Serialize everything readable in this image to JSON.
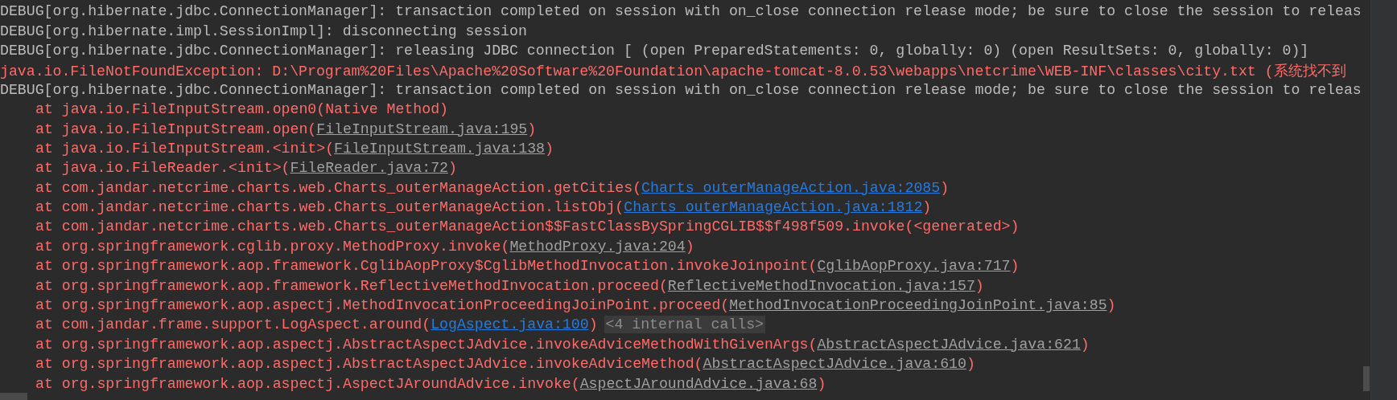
{
  "console": {
    "lines": [
      {
        "kind": "debug",
        "parts": [
          {
            "kind": "text",
            "text": "DEBUG[org.hibernate.jdbc.ConnectionManager]: transaction completed on session with on_close connection release mode; be sure to close the session to releas"
          }
        ]
      },
      {
        "kind": "debug",
        "parts": [
          {
            "kind": "text",
            "text": "DEBUG[org.hibernate.impl.SessionImpl]: disconnecting session"
          }
        ]
      },
      {
        "kind": "debug",
        "parts": [
          {
            "kind": "text",
            "text": "DEBUG[org.hibernate.jdbc.ConnectionManager]: releasing JDBC connection [ (open PreparedStatements: 0, globally: 0) (open ResultSets: 0, globally: 0)]"
          }
        ]
      },
      {
        "kind": "error",
        "parts": [
          {
            "kind": "text",
            "text": "java.io.FileNotFoundException: D:\\Program%20Files\\Apache%20Software%20Foundation\\apache-tomcat-8.0.53\\webapps\\netcrime\\WEB-INF\\classes\\city.txt (系统找不到"
          }
        ]
      },
      {
        "kind": "debug",
        "parts": [
          {
            "kind": "text",
            "text": "DEBUG[org.hibernate.jdbc.ConnectionManager]: transaction completed on session with on_close connection release mode; be sure to close the session to releas"
          }
        ]
      },
      {
        "kind": "frame",
        "parts": [
          {
            "kind": "text",
            "text": "at java.io.FileInputStream.open0(Native Method)"
          }
        ]
      },
      {
        "kind": "frame",
        "parts": [
          {
            "kind": "text",
            "text": "at java.io.FileInputStream.open("
          },
          {
            "kind": "library_link",
            "text": "FileInputStream.java:195"
          },
          {
            "kind": "text",
            "text": ")"
          }
        ]
      },
      {
        "kind": "frame",
        "parts": [
          {
            "kind": "text",
            "text": "at java.io.FileInputStream.<init>("
          },
          {
            "kind": "library_link",
            "text": "FileInputStream.java:138"
          },
          {
            "kind": "text",
            "text": ")"
          }
        ]
      },
      {
        "kind": "frame",
        "parts": [
          {
            "kind": "text",
            "text": "at java.io.FileReader.<init>("
          },
          {
            "kind": "library_link",
            "text": "FileReader.java:72"
          },
          {
            "kind": "text",
            "text": ")"
          }
        ]
      },
      {
        "kind": "frame",
        "parts": [
          {
            "kind": "text",
            "text": "at com.jandar.netcrime.charts.web.Charts_outerManageAction.getCities("
          },
          {
            "kind": "project_link",
            "text": "Charts_outerManageAction.java:2085"
          },
          {
            "kind": "text",
            "text": ")"
          }
        ]
      },
      {
        "kind": "frame",
        "parts": [
          {
            "kind": "text",
            "text": "at com.jandar.netcrime.charts.web.Charts_outerManageAction.listObj("
          },
          {
            "kind": "project_link",
            "text": "Charts_outerManageAction.java:1812"
          },
          {
            "kind": "text",
            "text": ")"
          }
        ]
      },
      {
        "kind": "frame",
        "parts": [
          {
            "kind": "text",
            "text": "at com.jandar.netcrime.charts.web.Charts_outerManageAction$$FastClassBySpringCGLIB$$f498f509.invoke(<generated>)"
          }
        ]
      },
      {
        "kind": "frame",
        "parts": [
          {
            "kind": "text",
            "text": "at org.springframework.cglib.proxy.MethodProxy.invoke("
          },
          {
            "kind": "library_link",
            "text": "MethodProxy.java:204"
          },
          {
            "kind": "text",
            "text": ")"
          }
        ]
      },
      {
        "kind": "frame",
        "parts": [
          {
            "kind": "text",
            "text": "at org.springframework.aop.framework.CglibAopProxy$CglibMethodInvocation.invokeJoinpoint("
          },
          {
            "kind": "library_link",
            "text": "CglibAopProxy.java:717"
          },
          {
            "kind": "text",
            "text": ")"
          }
        ]
      },
      {
        "kind": "frame",
        "parts": [
          {
            "kind": "text",
            "text": "at org.springframework.aop.framework.ReflectiveMethodInvocation.proceed("
          },
          {
            "kind": "library_link",
            "text": "ReflectiveMethodInvocation.java:157"
          },
          {
            "kind": "text",
            "text": ")"
          }
        ]
      },
      {
        "kind": "frame",
        "parts": [
          {
            "kind": "text",
            "text": "at org.springframework.aop.aspectj.MethodInvocationProceedingJoinPoint.proceed("
          },
          {
            "kind": "library_link",
            "text": "MethodInvocationProceedingJoinPoint.java:85"
          },
          {
            "kind": "text",
            "text": ")"
          }
        ]
      },
      {
        "kind": "frame",
        "parts": [
          {
            "kind": "text",
            "text": "at com.jandar.frame.support.LogAspect.around("
          },
          {
            "kind": "project_link",
            "text": "LogAspect.java:100"
          },
          {
            "kind": "text",
            "text": ")"
          }
        ],
        "folded": "<4 internal calls>"
      },
      {
        "kind": "frame",
        "parts": [
          {
            "kind": "text",
            "text": "at org.springframework.aop.aspectj.AbstractAspectJAdvice.invokeAdviceMethodWithGivenArgs("
          },
          {
            "kind": "library_link",
            "text": "AbstractAspectJAdvice.java:621"
          },
          {
            "kind": "text",
            "text": ")"
          }
        ]
      },
      {
        "kind": "frame",
        "parts": [
          {
            "kind": "text",
            "text": "at org.springframework.aop.aspectj.AbstractAspectJAdvice.invokeAdviceMethod("
          },
          {
            "kind": "library_link",
            "text": "AbstractAspectJAdvice.java:610"
          },
          {
            "kind": "text",
            "text": ")"
          }
        ]
      },
      {
        "kind": "frame",
        "parts": [
          {
            "kind": "text",
            "text": "at org.springframework.aop.aspectj.AspectJAroundAdvice.invoke("
          },
          {
            "kind": "library_link",
            "text": "AspectJAroundAdvice.java:68"
          },
          {
            "kind": "text",
            "text": ")"
          }
        ]
      }
    ]
  }
}
